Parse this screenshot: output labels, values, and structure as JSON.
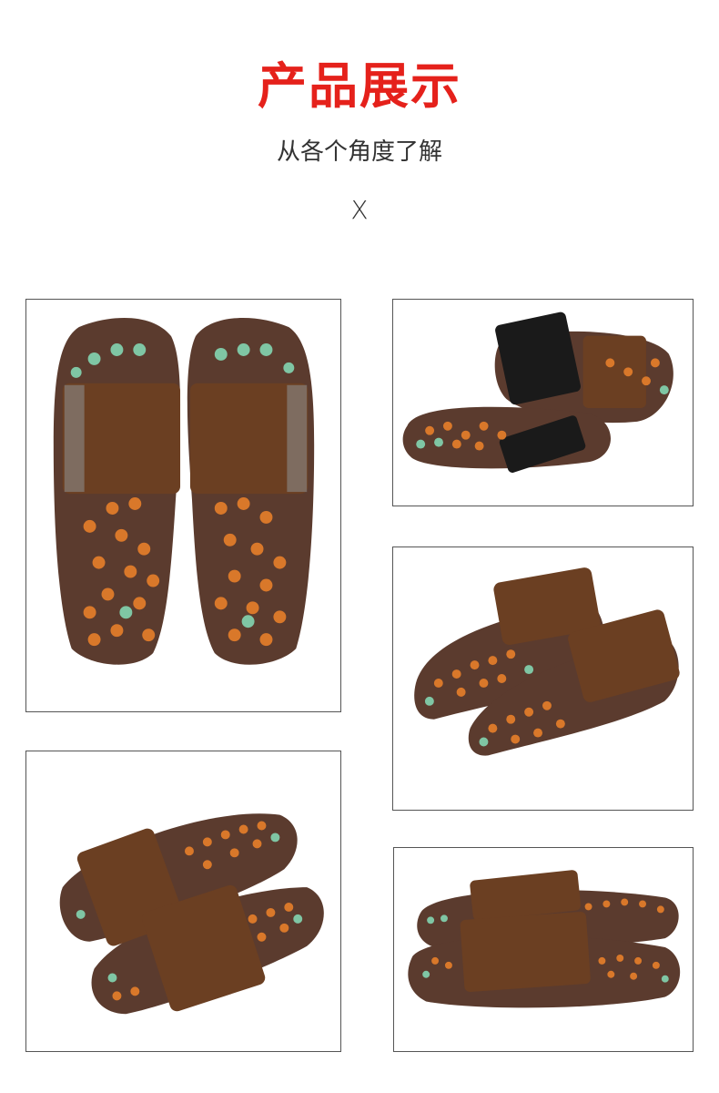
{
  "header": {
    "title": "产品展示",
    "subtitle": "从各个角度了解",
    "mark": "X"
  },
  "colors": {
    "title_red": "#e5211b",
    "sole_brown": "#5b3b2e",
    "strap_brown": "#6b3f22",
    "bead_orange": "#d9782a",
    "bead_jade": "#7fc6a4"
  },
  "gallery": [
    {
      "view": "top-view-pair"
    },
    {
      "view": "side-view-black-strap"
    },
    {
      "view": "angled-view-pair-right"
    },
    {
      "view": "angled-view-pair-left"
    },
    {
      "view": "low-angle-view-pair"
    }
  ]
}
